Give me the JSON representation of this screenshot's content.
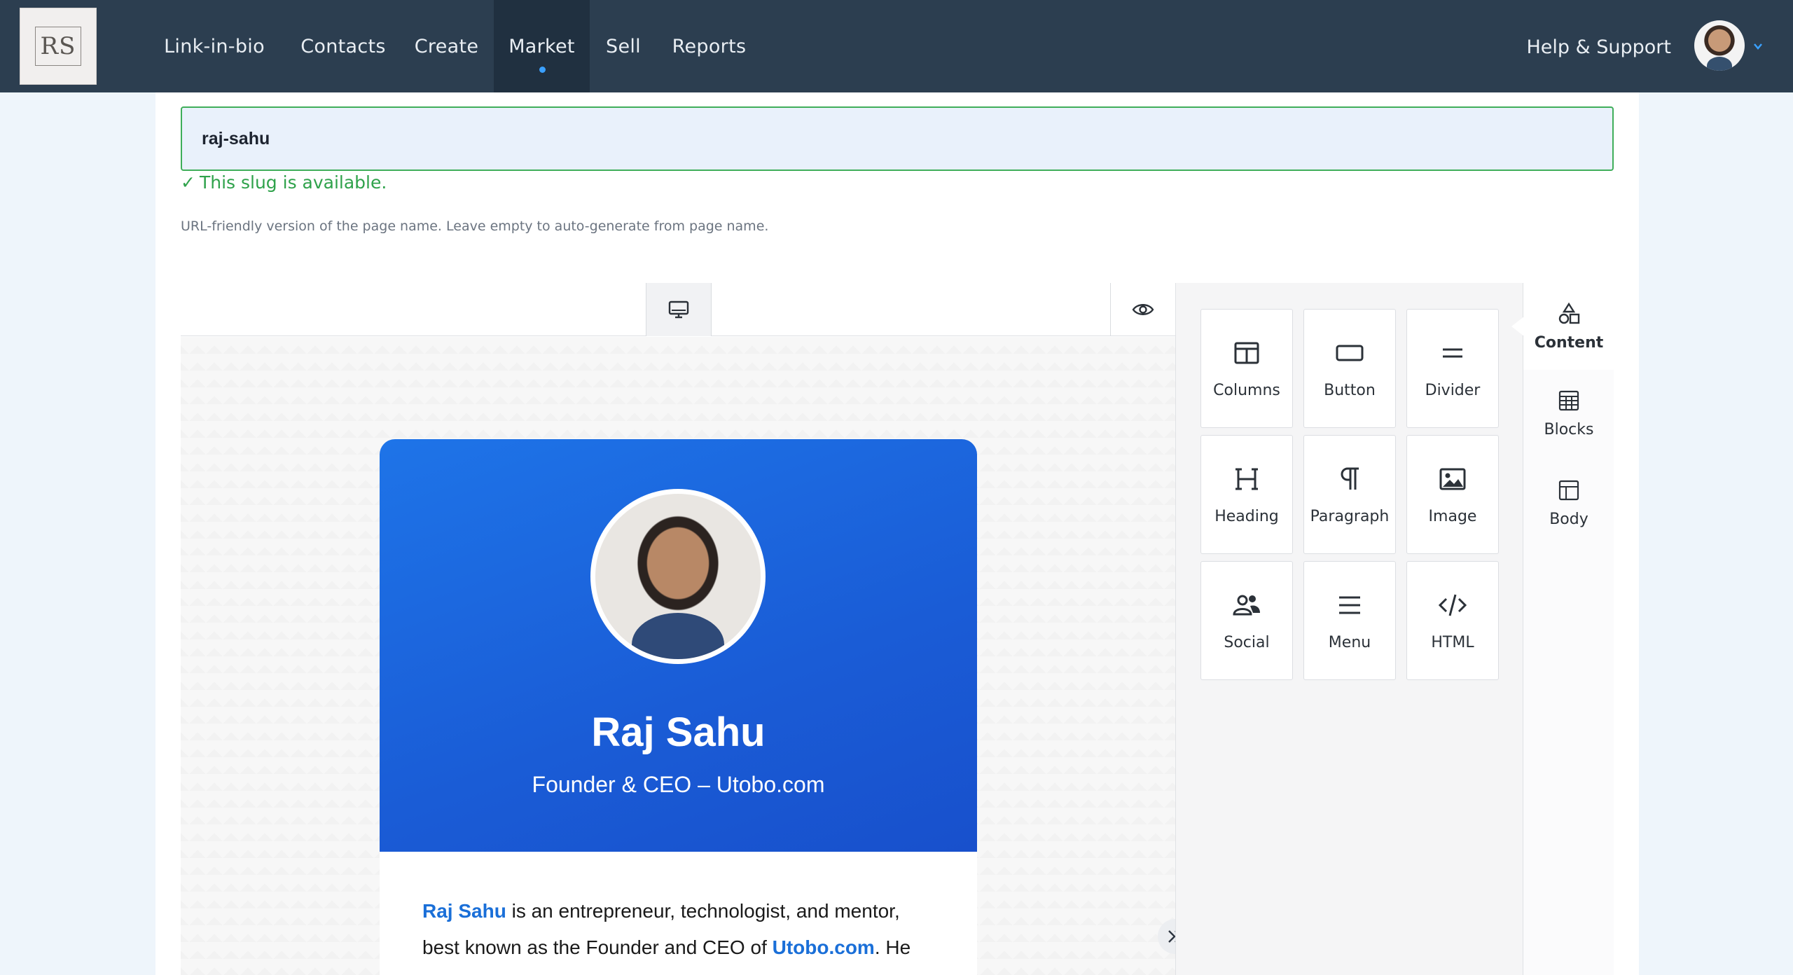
{
  "logo": {
    "text": "RS"
  },
  "nav": {
    "items": [
      "Link-in-bio",
      "Contacts",
      "Create",
      "Market",
      "Sell",
      "Reports"
    ],
    "active": "Market",
    "help": "Help & Support"
  },
  "slug": {
    "value": "raj-sahu",
    "status": "This slug is available.",
    "help": "URL-friendly version of the page name. Leave empty to auto-generate from page name."
  },
  "profile": {
    "name": "Raj Sahu",
    "subtitle": "Founder & CEO – Utobo.com",
    "bio_name": "Raj Sahu",
    "bio_text1": " is an entrepreneur, technologist, and mentor,",
    "bio_text2": "best known as the Founder and CEO of ",
    "bio_link": "Utobo.com",
    "bio_text3": ". He"
  },
  "tools": [
    {
      "label": "Columns",
      "icon": "columns-icon"
    },
    {
      "label": "Button",
      "icon": "button-icon"
    },
    {
      "label": "Divider",
      "icon": "divider-icon"
    },
    {
      "label": "Heading",
      "icon": "heading-icon"
    },
    {
      "label": "Paragraph",
      "icon": "paragraph-icon"
    },
    {
      "label": "Image",
      "icon": "image-icon"
    },
    {
      "label": "Social",
      "icon": "social-icon"
    },
    {
      "label": "Menu",
      "icon": "menu-icon"
    },
    {
      "label": "HTML",
      "icon": "html-icon"
    }
  ],
  "side_tabs": [
    {
      "label": "Content",
      "icon": "shapes-icon",
      "active": true
    },
    {
      "label": "Blocks",
      "icon": "blocks-icon"
    },
    {
      "label": "Body",
      "icon": "body-layout-icon"
    }
  ],
  "colors": {
    "nav_bg": "#2c3e50",
    "accent": "#3aa0ff",
    "success": "#2fa24b",
    "hero": "#1a5cd6",
    "link": "#1a6fd8"
  }
}
